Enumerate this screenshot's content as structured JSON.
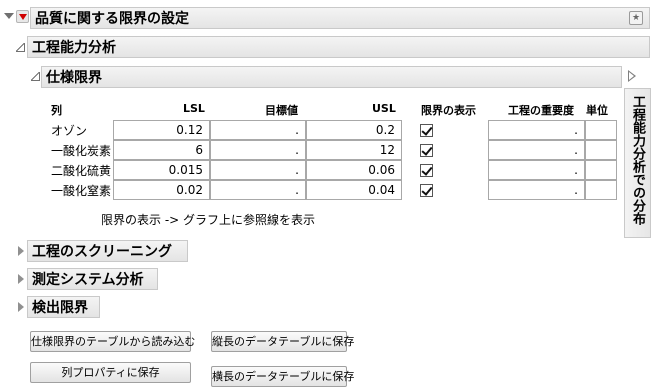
{
  "main": {
    "title": "品質に関する限界の設定"
  },
  "capability": {
    "title": "工程能力分析"
  },
  "spec": {
    "title": "仕様限界",
    "headers": {
      "col": "列",
      "lsl": "LSL",
      "target": "目標値",
      "usl": "USL",
      "show": "限界の表示",
      "importance": "工程の重要度",
      "unit": "単位"
    },
    "rows": [
      {
        "name": "オゾン",
        "lsl": "0.12",
        "target": ".",
        "usl": "0.2",
        "show": true,
        "importance": ".",
        "unit": ""
      },
      {
        "name": "一酸化炭素",
        "lsl": "6",
        "target": ".",
        "usl": "12",
        "show": true,
        "importance": ".",
        "unit": ""
      },
      {
        "name": "二酸化硫黄",
        "lsl": "0.015",
        "target": ".",
        "usl": "0.06",
        "show": true,
        "importance": ".",
        "unit": ""
      },
      {
        "name": "一酸化窒素",
        "lsl": "0.02",
        "target": ".",
        "usl": "0.04",
        "show": true,
        "importance": ".",
        "unit": ""
      }
    ],
    "note": "限界の表示 -> グラフ上に参照線を表示"
  },
  "side_panel": {
    "label": "工程能力分析での分布"
  },
  "sections": {
    "screening": "工程のスクリーニング",
    "msa": "測定システム分析",
    "detection": "検出限界"
  },
  "buttons": {
    "load_spec": "仕様限界のテーブルから読み込む",
    "save_tall": "縦長のデータテーブルに保存",
    "save_col_props": "列プロパティに保存",
    "save_wide": "横長のデータテーブルに保存"
  }
}
